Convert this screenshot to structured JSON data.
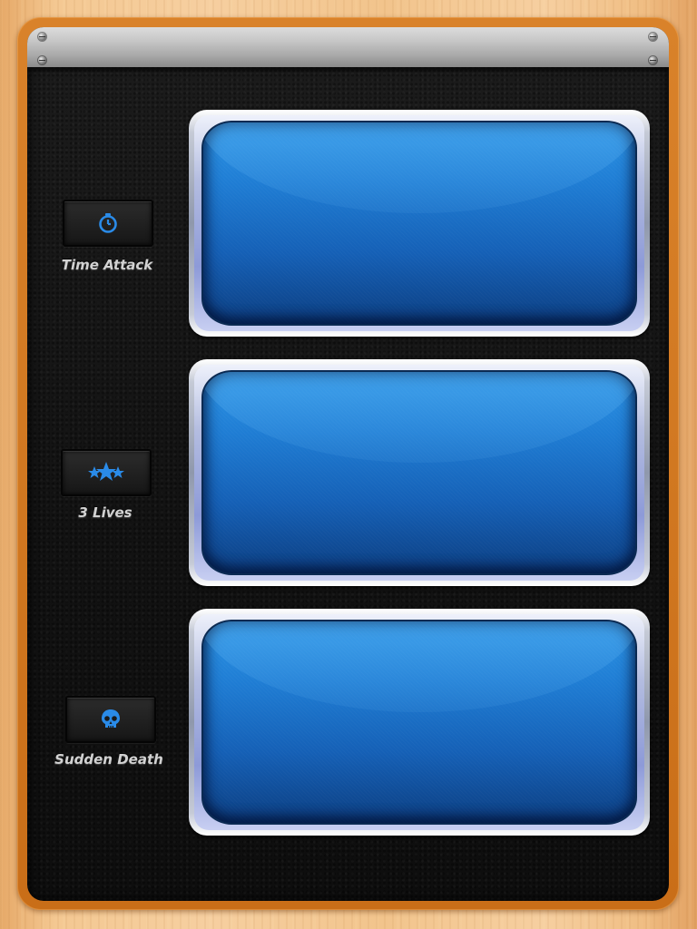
{
  "modes": [
    {
      "label": "Time Attack",
      "icon": "stopwatch-icon"
    },
    {
      "label": "3 Lives",
      "icon": "three-stars-icon"
    },
    {
      "label": "Sudden Death",
      "icon": "skull-icon"
    }
  ],
  "colors": {
    "icon_blue": "#2a8be8",
    "screen_blue": "#1f7dd4",
    "wood": "#f4c892",
    "frame_orange": "#d9822a",
    "leather": "#161616"
  }
}
